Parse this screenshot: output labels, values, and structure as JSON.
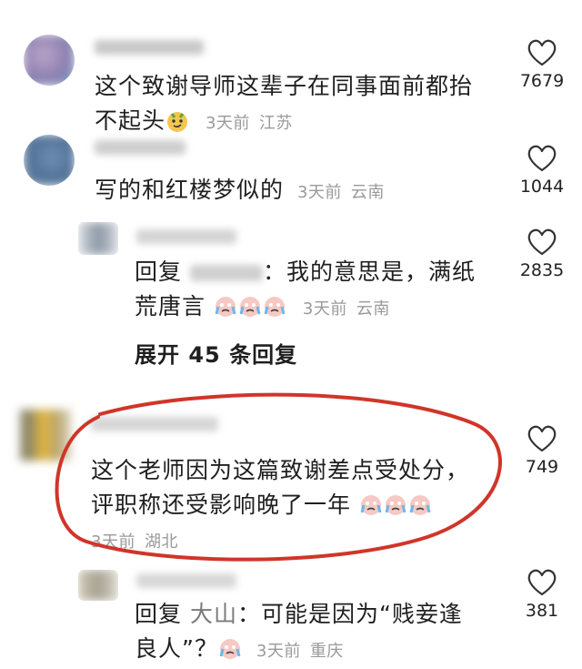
{
  "comments": [
    {
      "text_line1": "这个致谢导师这辈子在同事面前都抬",
      "text_line2": "不起头",
      "time": "3天前",
      "location": "江苏",
      "likes": "7679",
      "emoji": "smirk-face"
    },
    {
      "text_line1": "写的和红楼梦似的",
      "time": "3天前",
      "location": "云南",
      "likes": "1044"
    },
    {
      "reply_prefix": "回复",
      "reply_to": "",
      "text_line1": "：我的意思是，满纸",
      "text_line2": "荒唐言",
      "time": "3天前",
      "location": "云南",
      "likes": "2835",
      "emoji": "crying-face"
    },
    {
      "text_line1": "这个老师因为这篇致谢差点受处分，",
      "text_line2": "评职称还受影响晚了一年",
      "time": "3天前",
      "location": "湖北",
      "likes": "749",
      "emoji": "crying-face"
    },
    {
      "reply_prefix": "回复",
      "reply_to": "大山",
      "text_line1": "：可能是因为“贱妾逢",
      "text_line2": "良人”？",
      "time": "3天前",
      "location": "重庆",
      "likes": "381",
      "emoji": "crying-face"
    }
  ],
  "expand_replies": "展开 45 条回复",
  "colors": {
    "highlight": "#d0352a",
    "meta": "#9a9a9a"
  }
}
